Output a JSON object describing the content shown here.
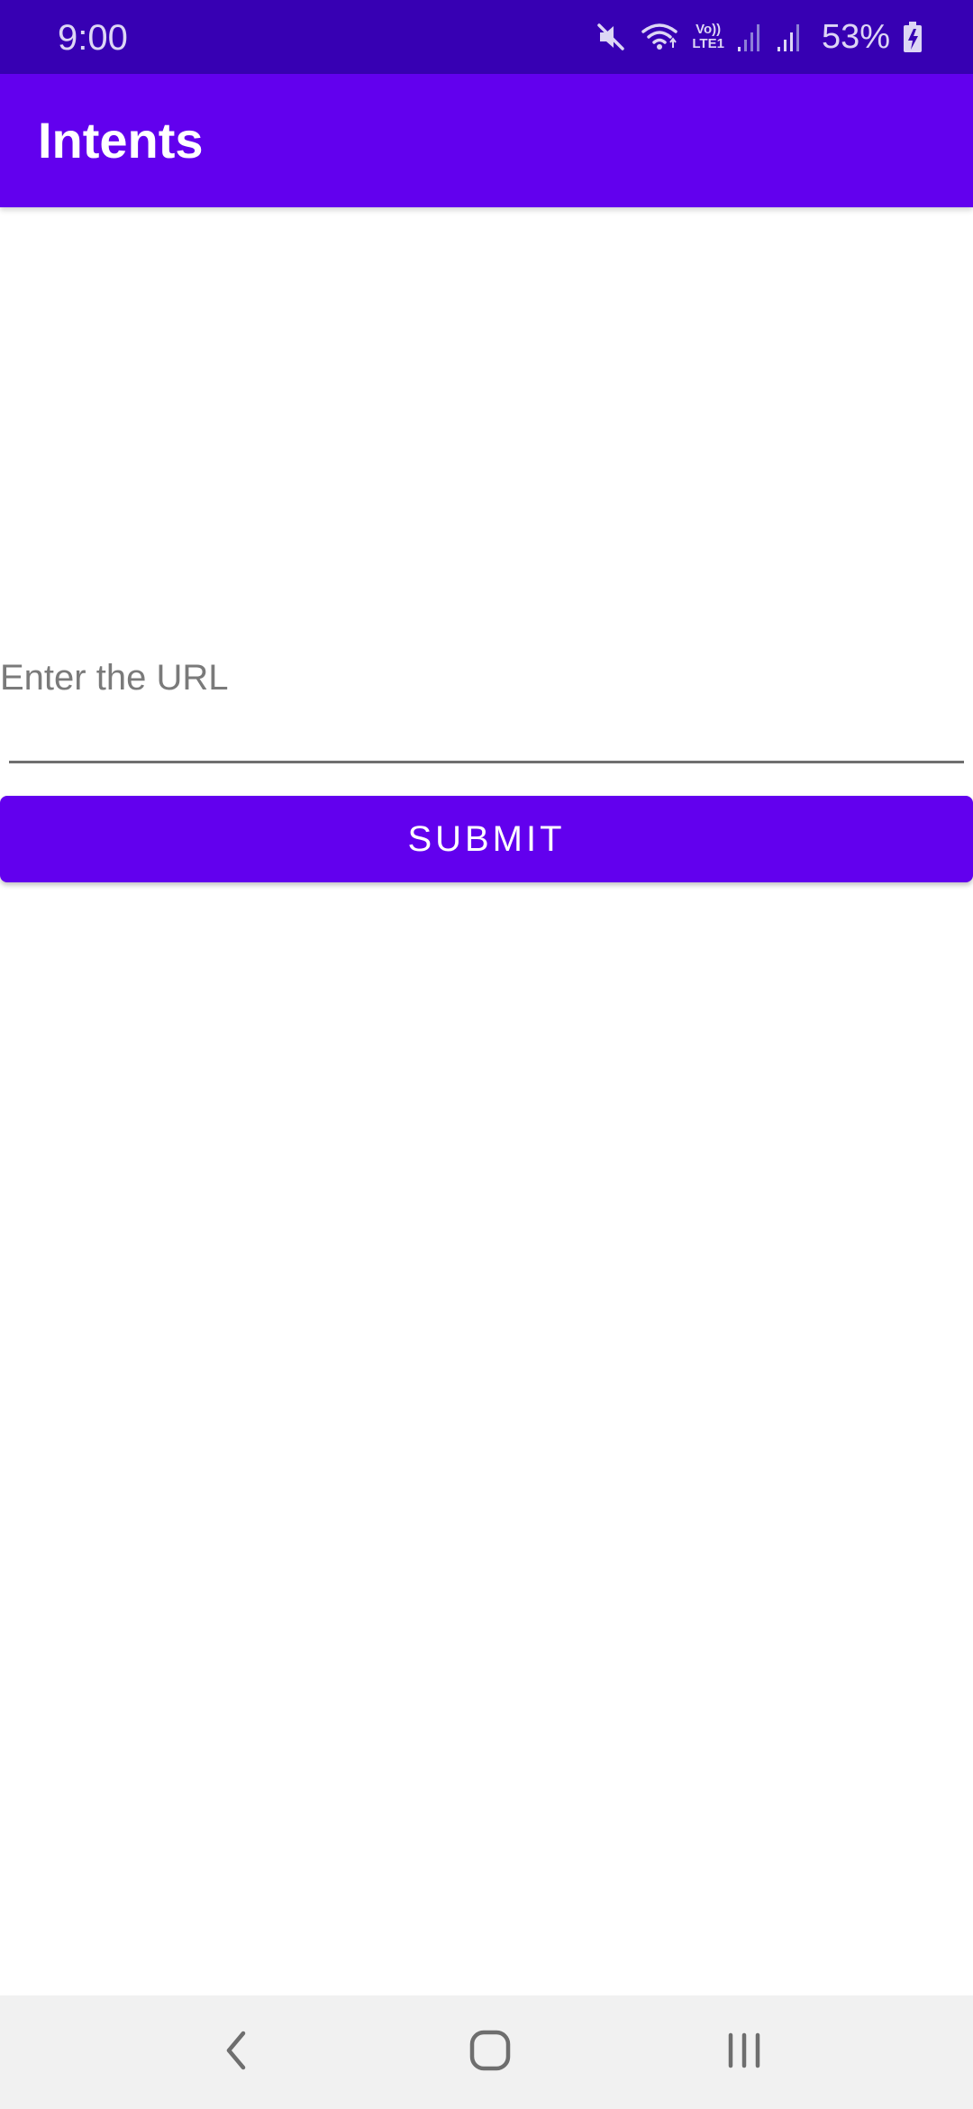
{
  "status_bar": {
    "time": "9:00",
    "battery": "53%",
    "network_label_top": "Vo))",
    "network_label_bottom": "LTE1",
    "icons": [
      "mute-icon",
      "wifi-icon",
      "volte-icon",
      "signal-icon",
      "signal-icon",
      "battery-charging-icon"
    ]
  },
  "app_bar": {
    "title": "Intents"
  },
  "form": {
    "url_placeholder": "Enter the URL",
    "url_value": "",
    "submit_label": "SUBMIT"
  },
  "nav_bar": {
    "icons": [
      "back-icon",
      "home-icon",
      "recents-icon"
    ]
  },
  "colors": {
    "status_bar": "#3700B3",
    "primary": "#6200EE",
    "nav_bar": "#F1F1F1"
  }
}
